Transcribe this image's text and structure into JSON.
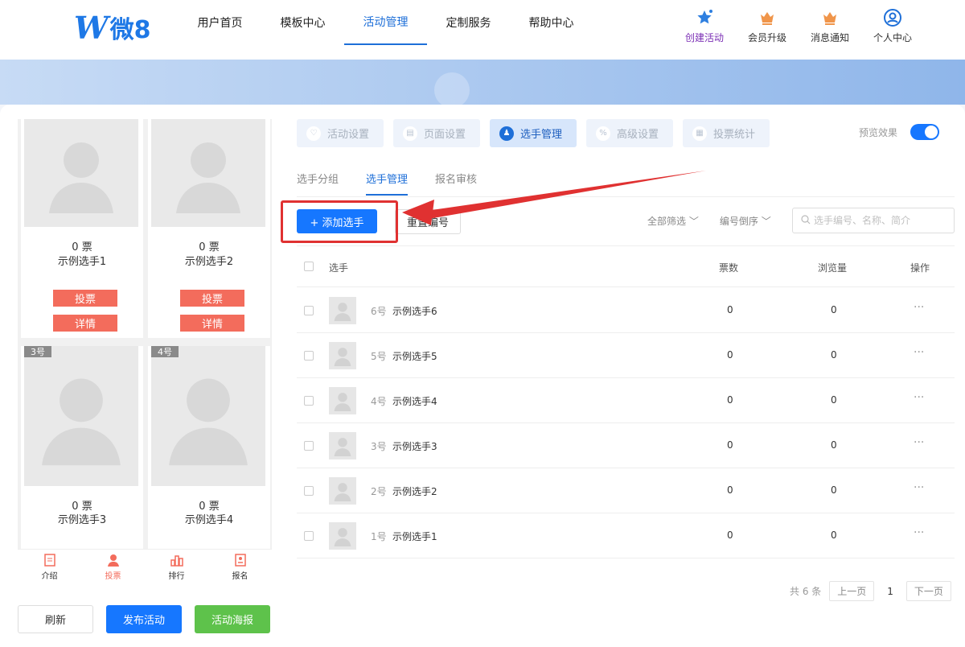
{
  "logo": {
    "mark": "W",
    "text": "微8"
  },
  "nav": [
    "用户首页",
    "模板中心",
    "活动管理",
    "定制服务",
    "帮助中心"
  ],
  "nav_active": 2,
  "tools": [
    {
      "label": "创建活动",
      "icon": "star-icon"
    },
    {
      "label": "会员升级",
      "icon": "crown-icon"
    },
    {
      "label": "消息通知",
      "icon": "bell-icon"
    },
    {
      "label": "个人中心",
      "icon": "user-icon"
    }
  ],
  "preview_cards": [
    {
      "votes": "0 票",
      "name": "示例选手1",
      "vote_btn": "投票",
      "detail_btn": "详情"
    },
    {
      "votes": "0 票",
      "name": "示例选手2",
      "vote_btn": "投票",
      "detail_btn": "详情"
    },
    {
      "number": "3号",
      "votes": "0 票",
      "name": "示例选手3"
    },
    {
      "number": "4号",
      "votes": "0 票",
      "name": "示例选手4"
    }
  ],
  "tabbar": [
    "介绍",
    "投票",
    "排行",
    "报名"
  ],
  "bottom_buttons": {
    "refresh": "刷新",
    "publish": "发布活动",
    "poster": "活动海报"
  },
  "steps": [
    "活动设置",
    "页面设置",
    "选手管理",
    "高级设置",
    "投票统计"
  ],
  "preview_label": "预览效果",
  "subtabs": [
    "选手分组",
    "选手管理",
    "报名审核"
  ],
  "add_button": "+ 添加选手",
  "renumber_button": "重置编号",
  "filters": [
    "全部筛选",
    "编号倒序"
  ],
  "search_placeholder": "选手编号、名称、简介",
  "table": {
    "headers": {
      "player": "选手",
      "votes": "票数",
      "views": "浏览量",
      "actions": "操作"
    },
    "rows": [
      {
        "num": "6号",
        "name": "示例选手6",
        "votes": "0",
        "views": "0"
      },
      {
        "num": "5号",
        "name": "示例选手5",
        "votes": "0",
        "views": "0"
      },
      {
        "num": "4号",
        "name": "示例选手4",
        "votes": "0",
        "views": "0"
      },
      {
        "num": "3号",
        "name": "示例选手3",
        "votes": "0",
        "views": "0"
      },
      {
        "num": "2号",
        "name": "示例选手2",
        "votes": "0",
        "views": "0"
      },
      {
        "num": "1号",
        "name": "示例选手1",
        "votes": "0",
        "views": "0"
      }
    ]
  },
  "pager": {
    "total": "共 6 条",
    "prev": "上一页",
    "current": "1",
    "next": "下一页"
  },
  "colors": {
    "primary": "#1677ff",
    "vote_red": "#f36c5c",
    "highlight": "#e03131",
    "poster_green": "#5ec24b"
  }
}
